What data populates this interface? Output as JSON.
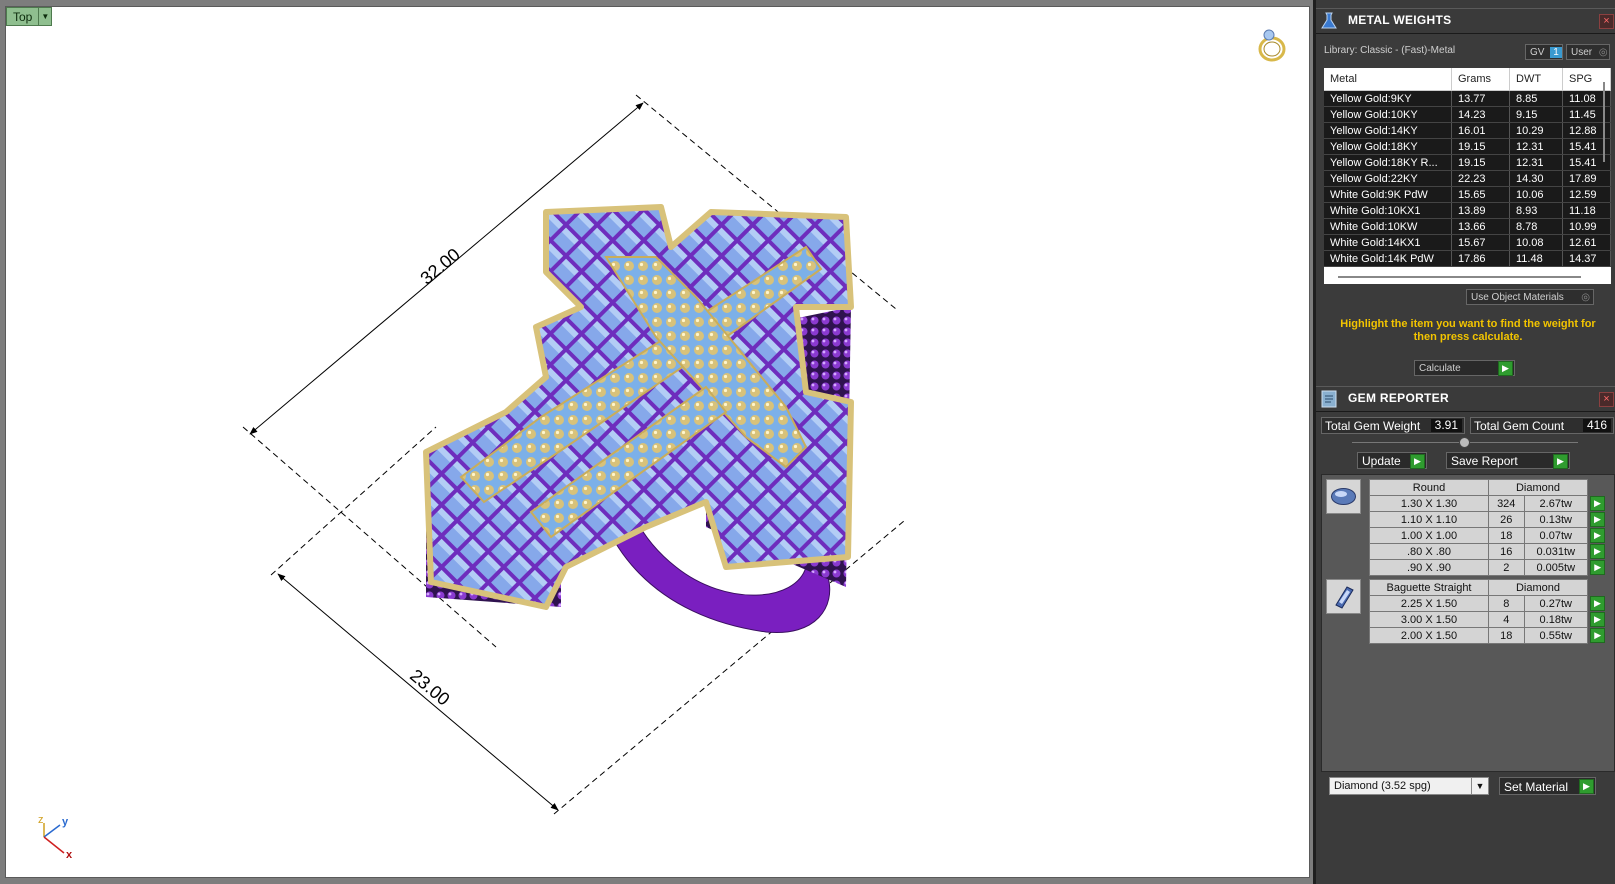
{
  "viewport": {
    "view_name": "Top",
    "dimensions": {
      "length": "32.00",
      "width": "23.00"
    },
    "axis": {
      "z": "z",
      "y": "y",
      "x": "x"
    }
  },
  "metal_weights": {
    "title": "METAL WEIGHTS",
    "library": "Library: Classic - (Fast)-Metal",
    "gv_label": "GV",
    "gv_value": "1",
    "user_label": "User",
    "columns": [
      "Metal",
      "Grams",
      "DWT",
      "SPG"
    ],
    "rows": [
      [
        "Yellow Gold:9KY",
        "13.77",
        "8.85",
        "11.08"
      ],
      [
        "Yellow Gold:10KY",
        "14.23",
        "9.15",
        "11.45"
      ],
      [
        "Yellow Gold:14KY",
        "16.01",
        "10.29",
        "12.88"
      ],
      [
        "Yellow Gold:18KY",
        "19.15",
        "12.31",
        "15.41"
      ],
      [
        "Yellow Gold:18KY R...",
        "19.15",
        "12.31",
        "15.41"
      ],
      [
        "Yellow Gold:22KY",
        "22.23",
        "14.30",
        "17.89"
      ],
      [
        "White Gold:9K PdW",
        "15.65",
        "10.06",
        "12.59"
      ],
      [
        "White Gold:10KX1",
        "13.89",
        "8.93",
        "11.18"
      ],
      [
        "White Gold:10KW",
        "13.66",
        "8.78",
        "10.99"
      ],
      [
        "White Gold:14KX1",
        "15.67",
        "10.08",
        "12.61"
      ],
      [
        "White Gold:14K PdW",
        "17.86",
        "11.48",
        "14.37"
      ]
    ],
    "use_object_materials": "Use Object Materials",
    "instruction": "Highlight the item you want to find the weight for then press calculate.",
    "calculate_label": "Calculate"
  },
  "gem_reporter": {
    "title": "GEM REPORTER",
    "total_weight_label": "Total Gem Weight",
    "total_weight_value": "3.91",
    "total_count_label": "Total Gem Count",
    "total_count_value": "416",
    "update_label": "Update",
    "save_report_label": "Save Report",
    "groups": [
      {
        "shape": "Round",
        "material": "Diamond",
        "rows": [
          [
            "1.30 X 1.30",
            "324",
            "2.67tw"
          ],
          [
            "1.10 X 1.10",
            "26",
            "0.13tw"
          ],
          [
            "1.00 X 1.00",
            "18",
            "0.07tw"
          ],
          [
            ".80 X .80",
            "16",
            "0.031tw"
          ],
          [
            ".90 X .90",
            "2",
            "0.005tw"
          ]
        ]
      },
      {
        "shape": "Baguette Straight",
        "material": "Diamond",
        "rows": [
          [
            "2.25 X 1.50",
            "8",
            "0.27tw"
          ],
          [
            "3.00 X 1.50",
            "4",
            "0.18tw"
          ],
          [
            "2.00 X 1.50",
            "18",
            "0.55tw"
          ]
        ]
      }
    ],
    "material_select": "Diamond     (3.52 spg)",
    "set_material_label": "Set Material"
  },
  "colors": {
    "accent_green": "#2f9c2f",
    "instruction_yellow": "#f2c400",
    "ring_purple": "#7a1fc0",
    "gold": "#d8c27a",
    "gem_blue": "#8fb0e8"
  }
}
